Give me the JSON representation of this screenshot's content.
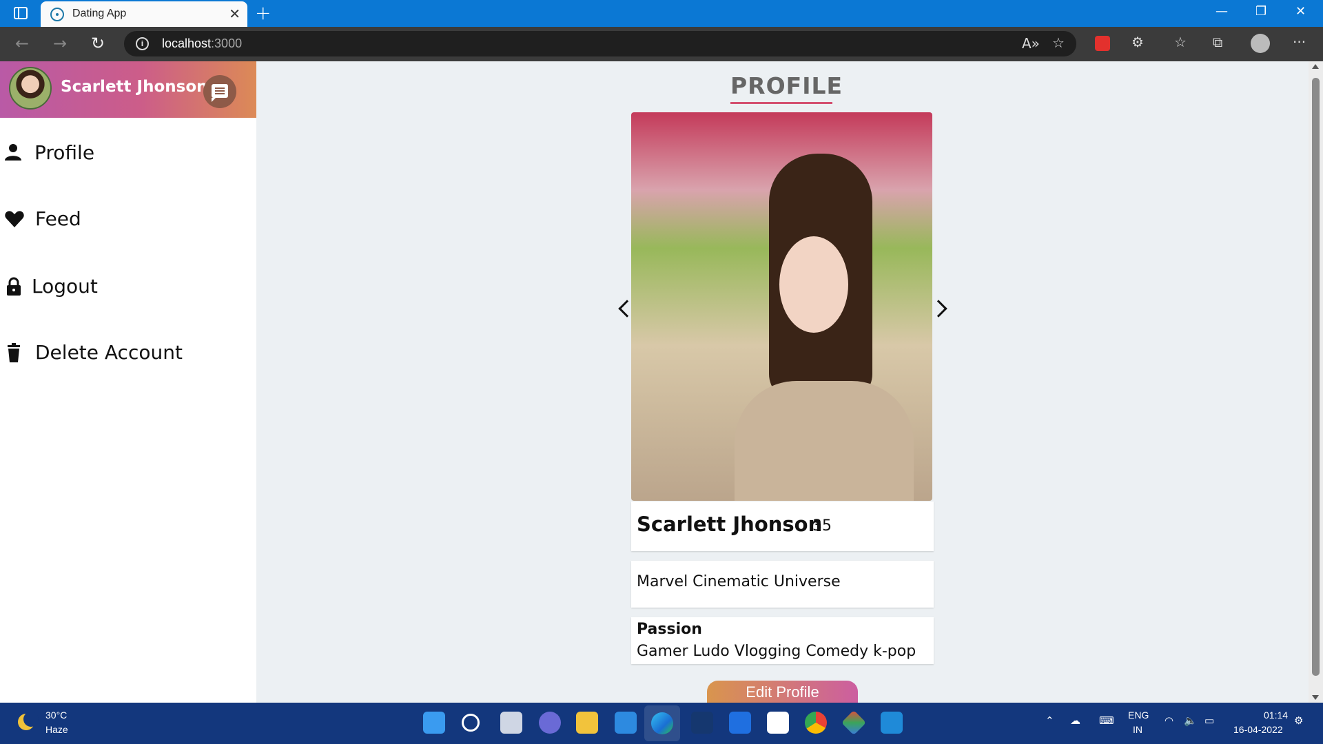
{
  "browser": {
    "tab_title": "Dating App",
    "url_host": "localhost",
    "url_port": ":3000"
  },
  "sidebar": {
    "user_name": "Scarlett Jhonson",
    "items": [
      {
        "label": "Profile",
        "icon": "person-icon"
      },
      {
        "label": "Feed",
        "icon": "heart-icon"
      },
      {
        "label": "Logout",
        "icon": "lock-icon"
      },
      {
        "label": "Delete Account",
        "icon": "trash-icon"
      }
    ]
  },
  "profile": {
    "page_title": "PROFILE",
    "name": "Scarlett Jhonson",
    "age": "35",
    "about": "Marvel Cinematic Universe",
    "passion_label": "Passion",
    "passions": "Gamer Ludo Vlogging Comedy k-pop",
    "edit_button": "Edit Profile"
  },
  "taskbar": {
    "temperature": "30°C",
    "weather": "Haze",
    "lang_1": "ENG",
    "lang_2": "IN",
    "time": "01:14",
    "date": "16-04-2022"
  },
  "colors": {
    "accent": "#0b78d4",
    "header_gradient_start": "#b95aa6",
    "header_gradient_end": "#dc8a56",
    "title_underline": "#d45070",
    "taskbar": "#13377d"
  }
}
